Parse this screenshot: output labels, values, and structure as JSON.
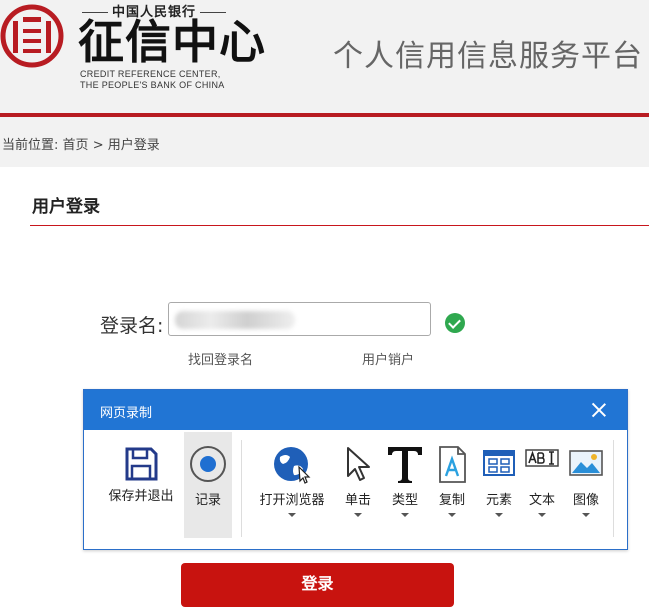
{
  "header": {
    "logo_top": "中国人民银行",
    "logo_main": "征信中心",
    "logo_en_line1": "CREDIT REFERENCE  CENTER,",
    "logo_en_line2": "THE PEOPLE'S BANK OF CHINA",
    "platform_title": "个人信用信息服务平台"
  },
  "breadcrumb": {
    "prefix": "当前位置:",
    "home": "首页",
    "separator": ">",
    "current": "用户登录"
  },
  "login": {
    "section_title": "用户登录",
    "username_label": "登录名:",
    "username_value": "",
    "recover_link": "找回登录名",
    "cancel_link": "用户销户",
    "submit_label": "登录"
  },
  "recorder": {
    "title": "网页录制",
    "tools": [
      {
        "label": "保存并退出",
        "icon": "floppy-disk-icon"
      },
      {
        "label": "记录",
        "icon": "record-icon"
      },
      {
        "label": "打开浏览器",
        "icon": "globe-icon"
      },
      {
        "label": "单击",
        "icon": "cursor-icon"
      },
      {
        "label": "类型",
        "icon": "text-type-icon"
      },
      {
        "label": "复制",
        "icon": "copy-document-icon"
      },
      {
        "label": "元素",
        "icon": "element-grid-icon"
      },
      {
        "label": "文本",
        "icon": "text-field-icon"
      },
      {
        "label": "图像",
        "icon": "image-icon"
      }
    ]
  },
  "colors": {
    "brand_red": "#c8130f",
    "dialog_blue": "#2175d4",
    "success_green": "#2fa84f"
  }
}
